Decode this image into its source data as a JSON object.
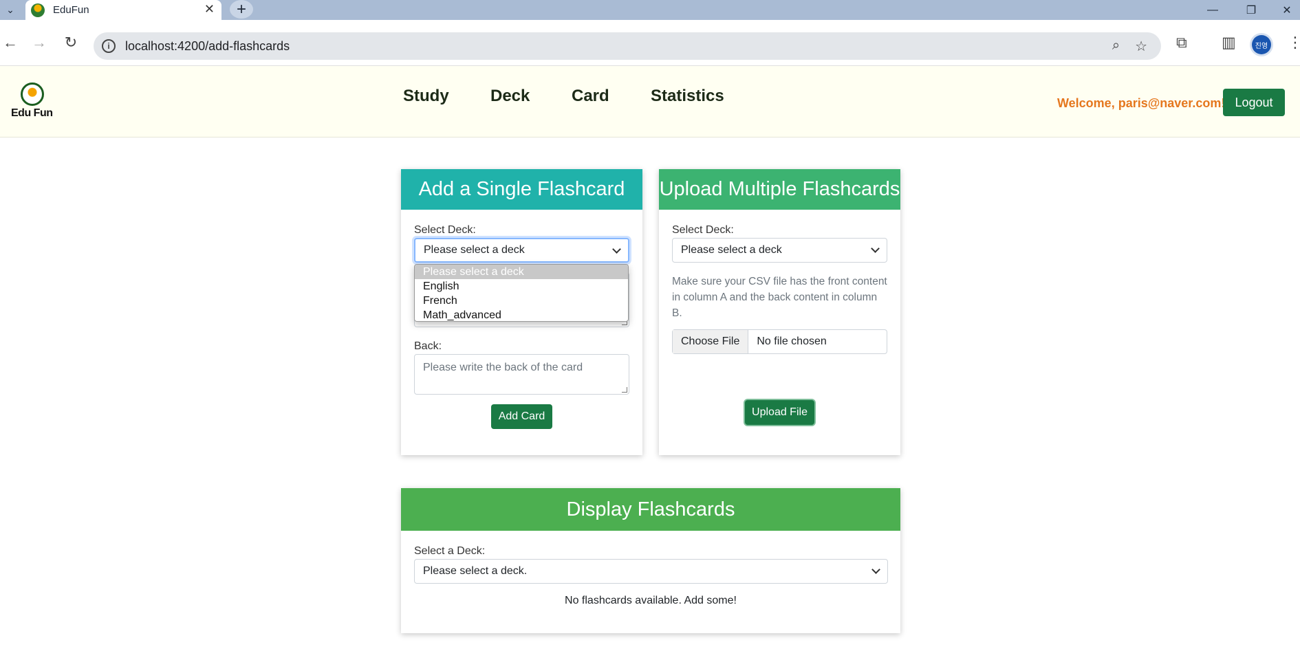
{
  "browser": {
    "tab_title": "EduFun",
    "url": "localhost:4200/add-flashcards",
    "profile_label": "진영"
  },
  "app": {
    "logo_text": "Edu Fun",
    "nav": [
      "Study",
      "Deck",
      "Card",
      "Statistics"
    ],
    "welcome": "Welcome, paris@naver.com!",
    "logout": "Logout"
  },
  "single_card": {
    "title": "Add a Single Flashcard",
    "select_label": "Select Deck:",
    "select_value": "Please select a deck",
    "dropdown_options": [
      "Please select a deck",
      "English",
      "French",
      "Math_advanced"
    ],
    "back_label": "Back:",
    "back_placeholder": "Please write the back of the card",
    "add_button": "Add Card",
    "header_color": "#20b2aa"
  },
  "upload": {
    "title": "Upload Multiple Flashcards",
    "select_label": "Select Deck:",
    "select_value": "Please select a deck",
    "hint": "Make sure your CSV file has the front content in column A and the back content in column B.",
    "choose_file": "Choose File",
    "no_file": "No file chosen",
    "upload_button": "Upload File",
    "header_color": "#3cb371"
  },
  "display": {
    "title": "Display Flashcards",
    "select_label": "Select a Deck:",
    "select_value": "Please select a deck.",
    "empty_message": "No flashcards available. Add some!",
    "header_color": "#4caf50"
  }
}
